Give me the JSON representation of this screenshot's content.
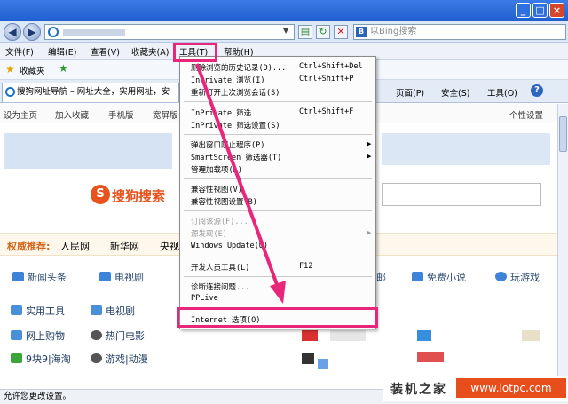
{
  "address": {
    "search_placeholder": "以Bing搜索",
    "search_logo": "B"
  },
  "menu": [
    {
      "label": "文件(F)"
    },
    {
      "label": "编辑(E)"
    },
    {
      "label": "查看(V)"
    },
    {
      "label": "收藏夹(A)"
    },
    {
      "label": "工具(T)"
    },
    {
      "label": "帮助(H)"
    }
  ],
  "favorites": {
    "label": "收藏夹"
  },
  "tab": {
    "title": "搜狗网址导航 – 网址大全，实用网址，安"
  },
  "command_bar": {
    "page": "页面(P)",
    "safety": "安全(S)",
    "tools": "工具(O)"
  },
  "page_links": {
    "set_home": "设为主页",
    "add_fav": "加入收藏",
    "mobile": "手机版",
    "widescreen": "宽屏版",
    "personal": "个性设置"
  },
  "sogou": {
    "logo_letter": "S",
    "logo_text": "搜狗搜索"
  },
  "hot_row": {
    "label": "权威推荐:",
    "sites": [
      "人民网",
      "新华网",
      "央视"
    ]
  },
  "nav_tabs": [
    {
      "label": "新闻头条"
    },
    {
      "label": "电视剧"
    },
    {
      "label": "邮"
    },
    {
      "label": "免费小说"
    },
    {
      "label": "玩游戏"
    }
  ],
  "side_links": [
    {
      "label": "实用工具"
    },
    {
      "label": "电视剧"
    },
    {
      "label": "网上购物"
    },
    {
      "label": "热门电影"
    },
    {
      "label": "9块9|海淘"
    },
    {
      "label": "游戏|动漫"
    }
  ],
  "tools_menu": {
    "items": [
      {
        "label": "删除浏览的历史记录(D)...",
        "shortcut": "Ctrl+Shift+Del"
      },
      {
        "label": "InPrivate 浏览(I)",
        "shortcut": "Ctrl+Shift+P"
      },
      {
        "label": "重新打开上次浏览会话(S)",
        "shortcut": ""
      },
      {
        "label": "InPrivate 筛选",
        "shortcut": "Ctrl+Shift+F"
      },
      {
        "label": "InPrivate 筛选设置(S)",
        "shortcut": ""
      },
      {
        "label": "弹出窗口阻止程序(P)",
        "shortcut": ""
      },
      {
        "label": "SmartScreen 筛选器(T)",
        "shortcut": ""
      },
      {
        "label": "管理加载项(A)",
        "shortcut": ""
      },
      {
        "label": "兼容性视图(V)",
        "shortcut": ""
      },
      {
        "label": "兼容性视图设置(B)",
        "shortcut": ""
      },
      {
        "label": "订阅该源(F)...",
        "shortcut": ""
      },
      {
        "label": "源发现(E)",
        "shortcut": ""
      },
      {
        "label": "Windows Update(U)",
        "shortcut": ""
      },
      {
        "label": "开发人员工具(L)",
        "shortcut": "F12"
      },
      {
        "label": "诊断连接问题...",
        "shortcut": ""
      },
      {
        "label": "PPLive",
        "shortcut": ""
      },
      {
        "label": "Internet 选项(O)",
        "shortcut": ""
      }
    ]
  },
  "status_bar": {
    "text": "允许您更改设置。"
  },
  "watermark": {
    "brand": "装机之家",
    "url": "www.lotpc.com"
  },
  "colors": {
    "highlight": "#e8267a",
    "sogou_orange": "#e8521d"
  }
}
